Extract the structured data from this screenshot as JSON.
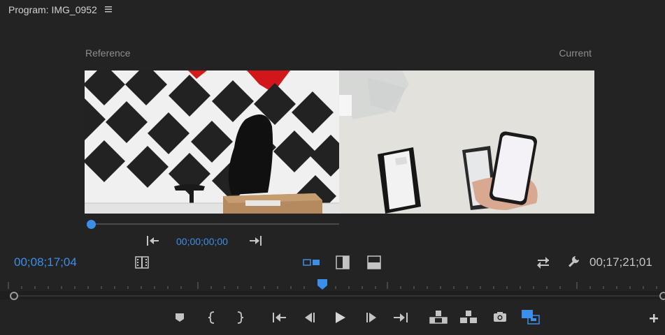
{
  "panel": {
    "title": "Program: IMG_0952"
  },
  "labels": {
    "reference": "Reference",
    "current": "Current"
  },
  "reference_controls": {
    "timecode": "00;00;00;00",
    "scrub_position": 0.0
  },
  "timecodes": {
    "playhead": "00;08;17;04",
    "duration": "00;17;21;01"
  },
  "timeline": {
    "playhead_position": 0.478
  },
  "icons": {
    "panel_menu": "hamburger-icon",
    "ref_go_to_in": "go-to-in-icon",
    "ref_go_to_out": "go-to-out-icon",
    "side_by_side": "side-by-side-icon",
    "vertical_split": "vertical-split-icon",
    "horizontal_split": "horizontal-split-icon",
    "swap_sides": "swap-icon",
    "settings": "wrench-icon",
    "transport": [
      "add-marker-icon",
      "mark-in-icon",
      "mark-out-icon",
      "go-to-in-icon",
      "step-back-icon",
      "play-icon",
      "step-forward-icon",
      "go-to-out-icon",
      "lift-icon",
      "extract-icon",
      "export-frame-icon",
      "comparison-view-icon",
      "add-button-icon"
    ]
  },
  "colors": {
    "accent": "#3d8ee8",
    "background": "#232323"
  }
}
